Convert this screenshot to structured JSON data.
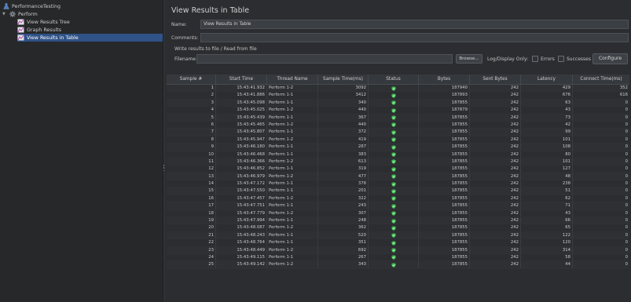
{
  "tree": {
    "root": "PerformanceTesting",
    "group": "Perform",
    "items": [
      {
        "label": "View Results Tree"
      },
      {
        "label": "Graph Results"
      },
      {
        "label": "View Results in Table"
      }
    ]
  },
  "panel": {
    "title": "View Results in Table",
    "name_label": "Name:",
    "name_value": "View Results in Table",
    "comments_label": "Comments:",
    "comments_value": "",
    "section_label": "Write results to file / Read from file",
    "filename_label": "Filename",
    "filename_value": "",
    "browse_label": "Browse...",
    "log_display_label": "Log/Display Only:",
    "errors_label": "Errors",
    "successes_label": "Successes",
    "configure_label": "Configure"
  },
  "table": {
    "columns": [
      "Sample #",
      "Start Time",
      "Thread Name",
      "Sample Time(ms)",
      "Status",
      "Bytes",
      "Sent Bytes",
      "Latency",
      "Connect Time(ms)"
    ],
    "rows": [
      [
        "1",
        "15:43:41.932",
        "Perform 1-2",
        "3092",
        "ok",
        "187940",
        "242",
        "429",
        "352"
      ],
      [
        "2",
        "15:43:41.886",
        "Perform 1-1",
        "3412",
        "ok",
        "187893",
        "242",
        "676",
        "616"
      ],
      [
        "3",
        "15:43:45.098",
        "Perform 1-1",
        "340",
        "ok",
        "187855",
        "242",
        "63",
        "0"
      ],
      [
        "4",
        "15:43:45.025",
        "Perform 1-2",
        "440",
        "ok",
        "187879",
        "242",
        "43",
        "0"
      ],
      [
        "5",
        "15:43:45.439",
        "Perform 1-1",
        "367",
        "ok",
        "187855",
        "242",
        "73",
        "0"
      ],
      [
        "6",
        "15:43:45.465",
        "Perform 1-2",
        "440",
        "ok",
        "187855",
        "242",
        "42",
        "0"
      ],
      [
        "7",
        "15:43:45.807",
        "Perform 1-1",
        "372",
        "ok",
        "187855",
        "242",
        "99",
        "0"
      ],
      [
        "8",
        "15:43:45.947",
        "Perform 1-2",
        "419",
        "ok",
        "187855",
        "242",
        "101",
        "0"
      ],
      [
        "9",
        "15:43:46.180",
        "Perform 1-1",
        "287",
        "ok",
        "187855",
        "242",
        "108",
        "0"
      ],
      [
        "10",
        "15:43:46.468",
        "Perform 1-1",
        "383",
        "ok",
        "187855",
        "242",
        "80",
        "0"
      ],
      [
        "11",
        "15:43:46.366",
        "Perform 1-2",
        "613",
        "ok",
        "187855",
        "242",
        "101",
        "0"
      ],
      [
        "12",
        "15:43:46.852",
        "Perform 1-1",
        "319",
        "ok",
        "187855",
        "242",
        "127",
        "0"
      ],
      [
        "13",
        "15:43:46.979",
        "Perform 1-2",
        "477",
        "ok",
        "187855",
        "242",
        "48",
        "0"
      ],
      [
        "14",
        "15:43:47.172",
        "Perform 1-1",
        "378",
        "ok",
        "187855",
        "242",
        "238",
        "0"
      ],
      [
        "15",
        "15:43:47.550",
        "Perform 1-1",
        "201",
        "ok",
        "187855",
        "242",
        "51",
        "0"
      ],
      [
        "16",
        "15:43:47.457",
        "Perform 1-2",
        "322",
        "ok",
        "187855",
        "242",
        "62",
        "0"
      ],
      [
        "17",
        "15:43:47.751",
        "Perform 1-1",
        "243",
        "ok",
        "187855",
        "242",
        "71",
        "0"
      ],
      [
        "18",
        "15:43:47.779",
        "Perform 1-2",
        "307",
        "ok",
        "187855",
        "242",
        "43",
        "0"
      ],
      [
        "19",
        "15:43:47.994",
        "Perform 1-1",
        "248",
        "ok",
        "187855",
        "242",
        "66",
        "0"
      ],
      [
        "20",
        "15:43:48.087",
        "Perform 1-2",
        "362",
        "ok",
        "187855",
        "242",
        "65",
        "0"
      ],
      [
        "21",
        "15:43:48.243",
        "Perform 1-1",
        "520",
        "ok",
        "187855",
        "242",
        "122",
        "0"
      ],
      [
        "22",
        "15:43:48.764",
        "Perform 1-1",
        "351",
        "ok",
        "187855",
        "242",
        "120",
        "0"
      ],
      [
        "23",
        "15:43:48.449",
        "Perform 1-2",
        "692",
        "ok",
        "187855",
        "242",
        "314",
        "0"
      ],
      [
        "24",
        "15:43:49.115",
        "Perform 1-1",
        "267",
        "ok",
        "187855",
        "242",
        "58",
        "0"
      ],
      [
        "25",
        "15:43:49.142",
        "Perform 1-2",
        "343",
        "ok",
        "187855",
        "242",
        "44",
        "0"
      ]
    ]
  },
  "colors": {
    "selection": "#2f5287",
    "status_ok": "#3fb950",
    "background": "#2b2d30"
  },
  "icons": {
    "root": "flask-icon",
    "group": "gear-icon",
    "listener": "chart-icon",
    "status": "shield-check-icon"
  }
}
